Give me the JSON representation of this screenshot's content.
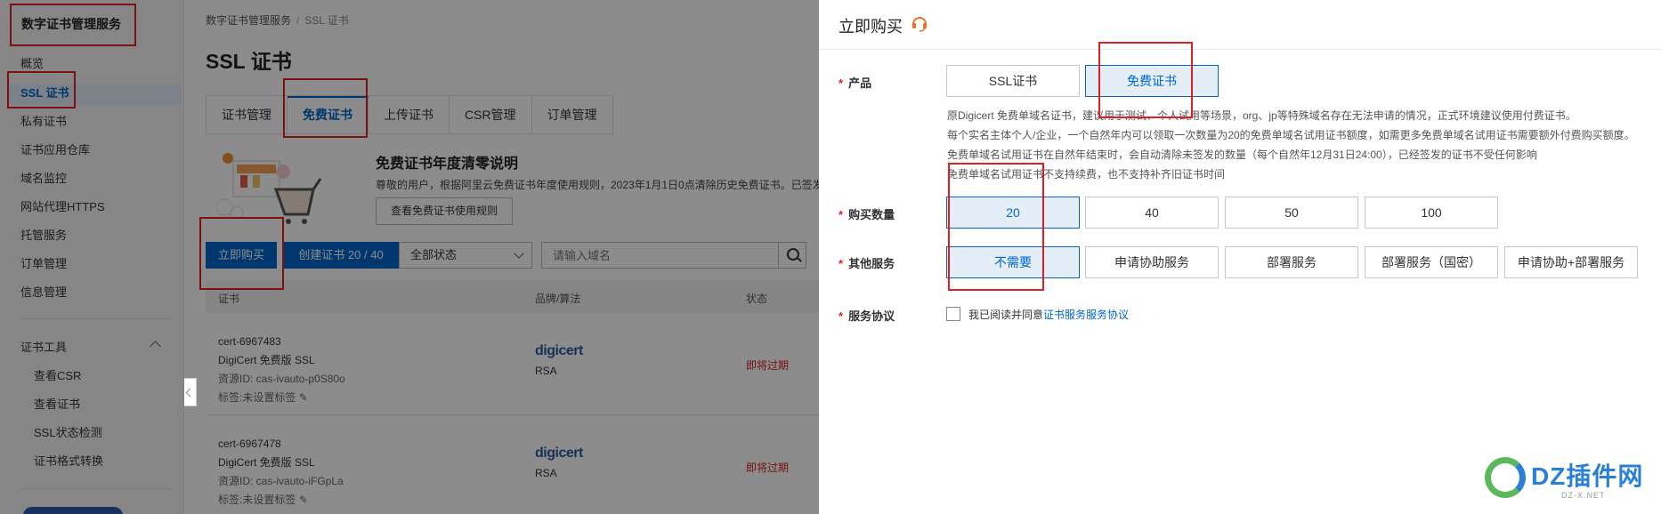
{
  "sidebar": {
    "title": "数字证书管理服务",
    "items": [
      {
        "label": "概览",
        "active": false
      },
      {
        "label": "SSL 证书",
        "active": true
      },
      {
        "label": "私有证书",
        "active": false
      },
      {
        "label": "证书应用仓库",
        "active": false
      },
      {
        "label": "域名监控",
        "active": false
      },
      {
        "label": "网站代理HTTPS",
        "active": false
      },
      {
        "label": "托管服务",
        "active": false
      },
      {
        "label": "订单管理",
        "active": false
      },
      {
        "label": "信息管理",
        "active": false
      }
    ],
    "tools_group": {
      "label": "证书工具",
      "items": [
        "查看CSR",
        "查看证书",
        "SSL状态检测",
        "证书格式转换"
      ]
    }
  },
  "main": {
    "breadcrumb": [
      "数字证书管理服务",
      "SSL 证书"
    ],
    "title": "SSL 证书",
    "tabs": [
      {
        "label": "证书管理",
        "active": false
      },
      {
        "label": "免费证书",
        "active": true
      },
      {
        "label": "上传证书",
        "active": false
      },
      {
        "label": "CSR管理",
        "active": false
      },
      {
        "label": "订单管理",
        "active": false
      }
    ],
    "notice": {
      "title": "免费证书年度清零说明",
      "desc": "尊敬的用户，根据阿里云免费证书年度使用规则，2023年1月1日0点清除历史免费证书。已签发",
      "button": "查看免费证书使用规则"
    },
    "toolbar": {
      "buy_label": "立即购买",
      "create_label": "创建证书 20 / 40",
      "status_value": "全部状态",
      "domain_placeholder": "请输入域名"
    },
    "table": {
      "headers": [
        "证书",
        "品牌/算法",
        "状态"
      ],
      "rows": [
        {
          "id": "cert-6967483",
          "type": "DigiCert 免费版 SSL",
          "resource": "资源ID: cas-ivauto-p0S80o",
          "tag": "标签:未设置标签",
          "brand": "digicert",
          "algo": "RSA",
          "status": "即将过期"
        },
        {
          "id": "cert-6967478",
          "type": "DigiCert 免费版 SSL",
          "resource": "资源ID: cas-ivauto-iFGpLa",
          "tag": "标签:未设置标签",
          "brand": "digicert",
          "algo": "RSA",
          "status": "即将过期"
        }
      ]
    }
  },
  "drawer": {
    "title": "立即购买",
    "product": {
      "label": "产品",
      "options": [
        {
          "label": "SSL证书",
          "selected": false
        },
        {
          "label": "免费证书",
          "selected": true
        }
      ],
      "help": [
        "原Digicert 免费单域名证书，建议用于测试、个人试用等场景，org、jp等特殊域名存在无法申请的情况，正式环境建议使用付费证书。",
        "每个实名主体个人/企业，一个自然年内可以领取一次数量为20的免费单域名试用证书额度，如需更多免费单域名试用证书需要额外付费购买额度。",
        "免费单域名试用证书在自然年结束时，会自动清除未签发的数量（每个自然年12月31日24:00），已经签发的证书不受任何影响",
        "免费单域名试用证书不支持续费，也不支持补齐旧证书时间"
      ]
    },
    "quantity": {
      "label": "购买数量",
      "options": [
        {
          "label": "20",
          "selected": true
        },
        {
          "label": "40",
          "selected": false
        },
        {
          "label": "50",
          "selected": false
        },
        {
          "label": "100",
          "selected": false
        }
      ]
    },
    "services": {
      "label": "其他服务",
      "options": [
        {
          "label": "不需要",
          "selected": true
        },
        {
          "label": "申请协助服务",
          "selected": false
        },
        {
          "label": "部署服务",
          "selected": false
        },
        {
          "label": "部署服务（国密）",
          "selected": false
        },
        {
          "label": "申请协助+部署服务",
          "selected": false
        }
      ]
    },
    "agreement": {
      "label": "服务协议",
      "text": "我已阅读并同意",
      "link": "证书服务服务协议",
      "checked": false
    }
  },
  "watermark": {
    "title": "DZ插件网",
    "sub": "DZ-X.NET"
  },
  "colors": {
    "accent": "#0064c8",
    "annotation_red": "#e02020",
    "expiring_red": "#d32020"
  }
}
